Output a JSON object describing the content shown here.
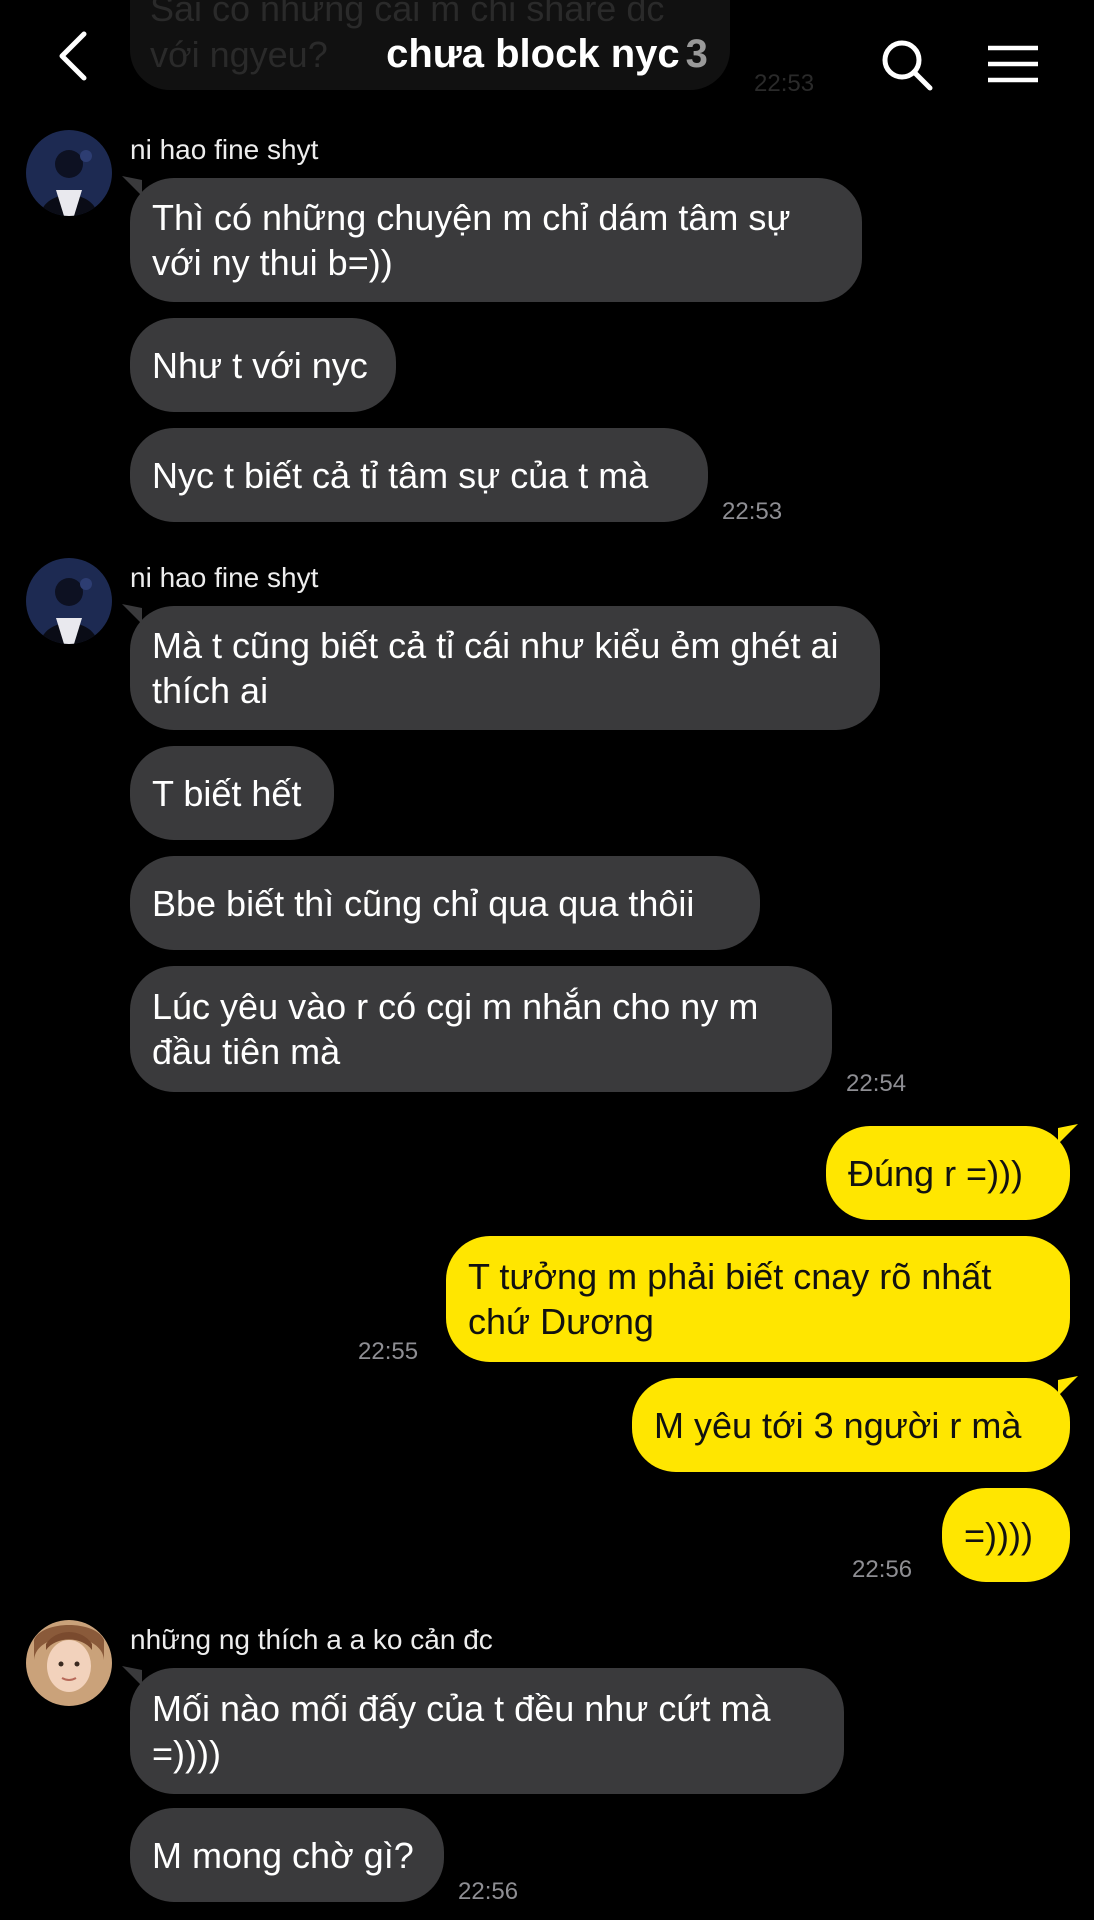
{
  "header": {
    "title": "chưa block nyc",
    "member_count": "3",
    "previous_message": "Sẵi có những cái m chỉ share đc với ngyeu?",
    "previous_time": "22:53"
  },
  "messages": {
    "g1": {
      "sender": "ni hao fine shyt",
      "m1": "Thì có những chuyện m chỉ dám tâm sự với ny thui b=))",
      "m2": "Như t với nyc",
      "m3": "Nyc t biết cả tỉ tâm sự của t mà",
      "time": "22:53"
    },
    "g2": {
      "sender": "ni hao fine shyt",
      "m1": "Mà t cũng biết cả tỉ cái như kiểu ẻm ghét ai thích ai",
      "m2": "T biết hết",
      "m3": "Bbe biết thì cũng chỉ qua qua thôii",
      "m4": "Lúc yêu vào r có cgi m nhắn cho ny m đầu tiên mà",
      "time": "22:54"
    },
    "me1": {
      "m1": "Đúng r =)))",
      "m2": "T tưởng m phải biết cnay rõ nhất chứ Dương",
      "time": "22:55"
    },
    "me2": {
      "m1": "M yêu tới 3 người r mà",
      "m2": "=))))",
      "time": "22:56"
    },
    "g3": {
      "sender": "những ng thích a a ko cản đc",
      "m1": "Mối nào mối đấy của t đều như cứt mà =))))",
      "m2": "M mong chờ gì?",
      "time": "22:56"
    }
  },
  "colors": {
    "background": "#000000",
    "incoming_bubble": "#3a3a3c",
    "outgoing_bubble": "#ffe600",
    "timestamp": "#8e8e93"
  },
  "icons": [
    "back-icon",
    "search-icon",
    "menu-icon"
  ]
}
